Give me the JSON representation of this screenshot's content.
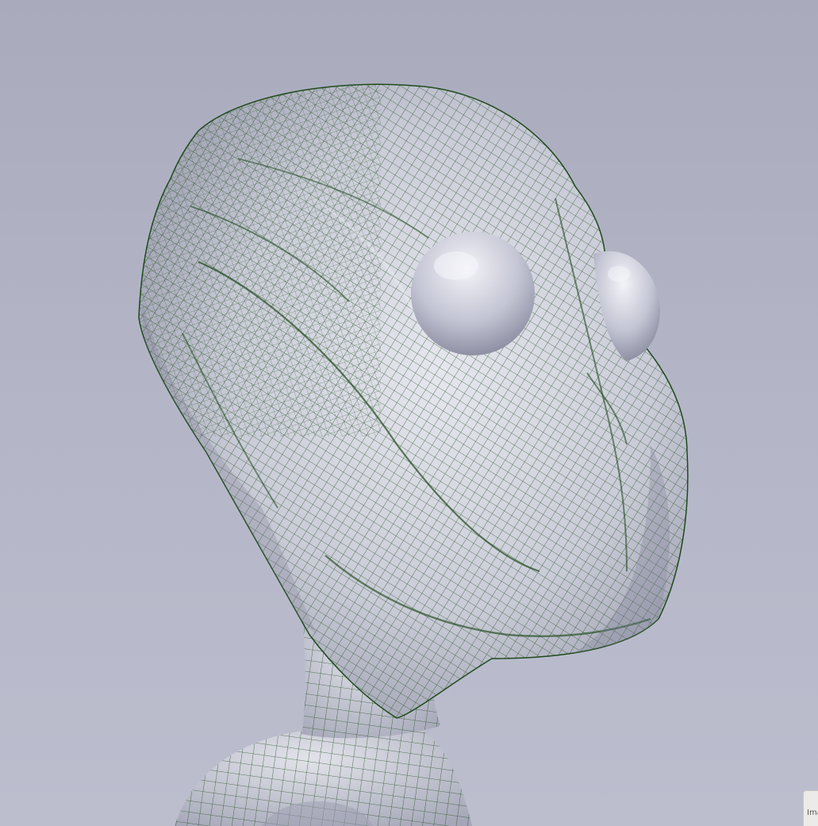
{
  "viewport": {
    "background_color": "#b3b5c7",
    "model": {
      "shading_color": "#c7c9d6",
      "wireframe_color": "#1f4a1c",
      "eye_color": "#c9cad9",
      "display_mode": "shaded-with-wireframe"
    }
  },
  "status_chip": {
    "label": "Ima"
  }
}
